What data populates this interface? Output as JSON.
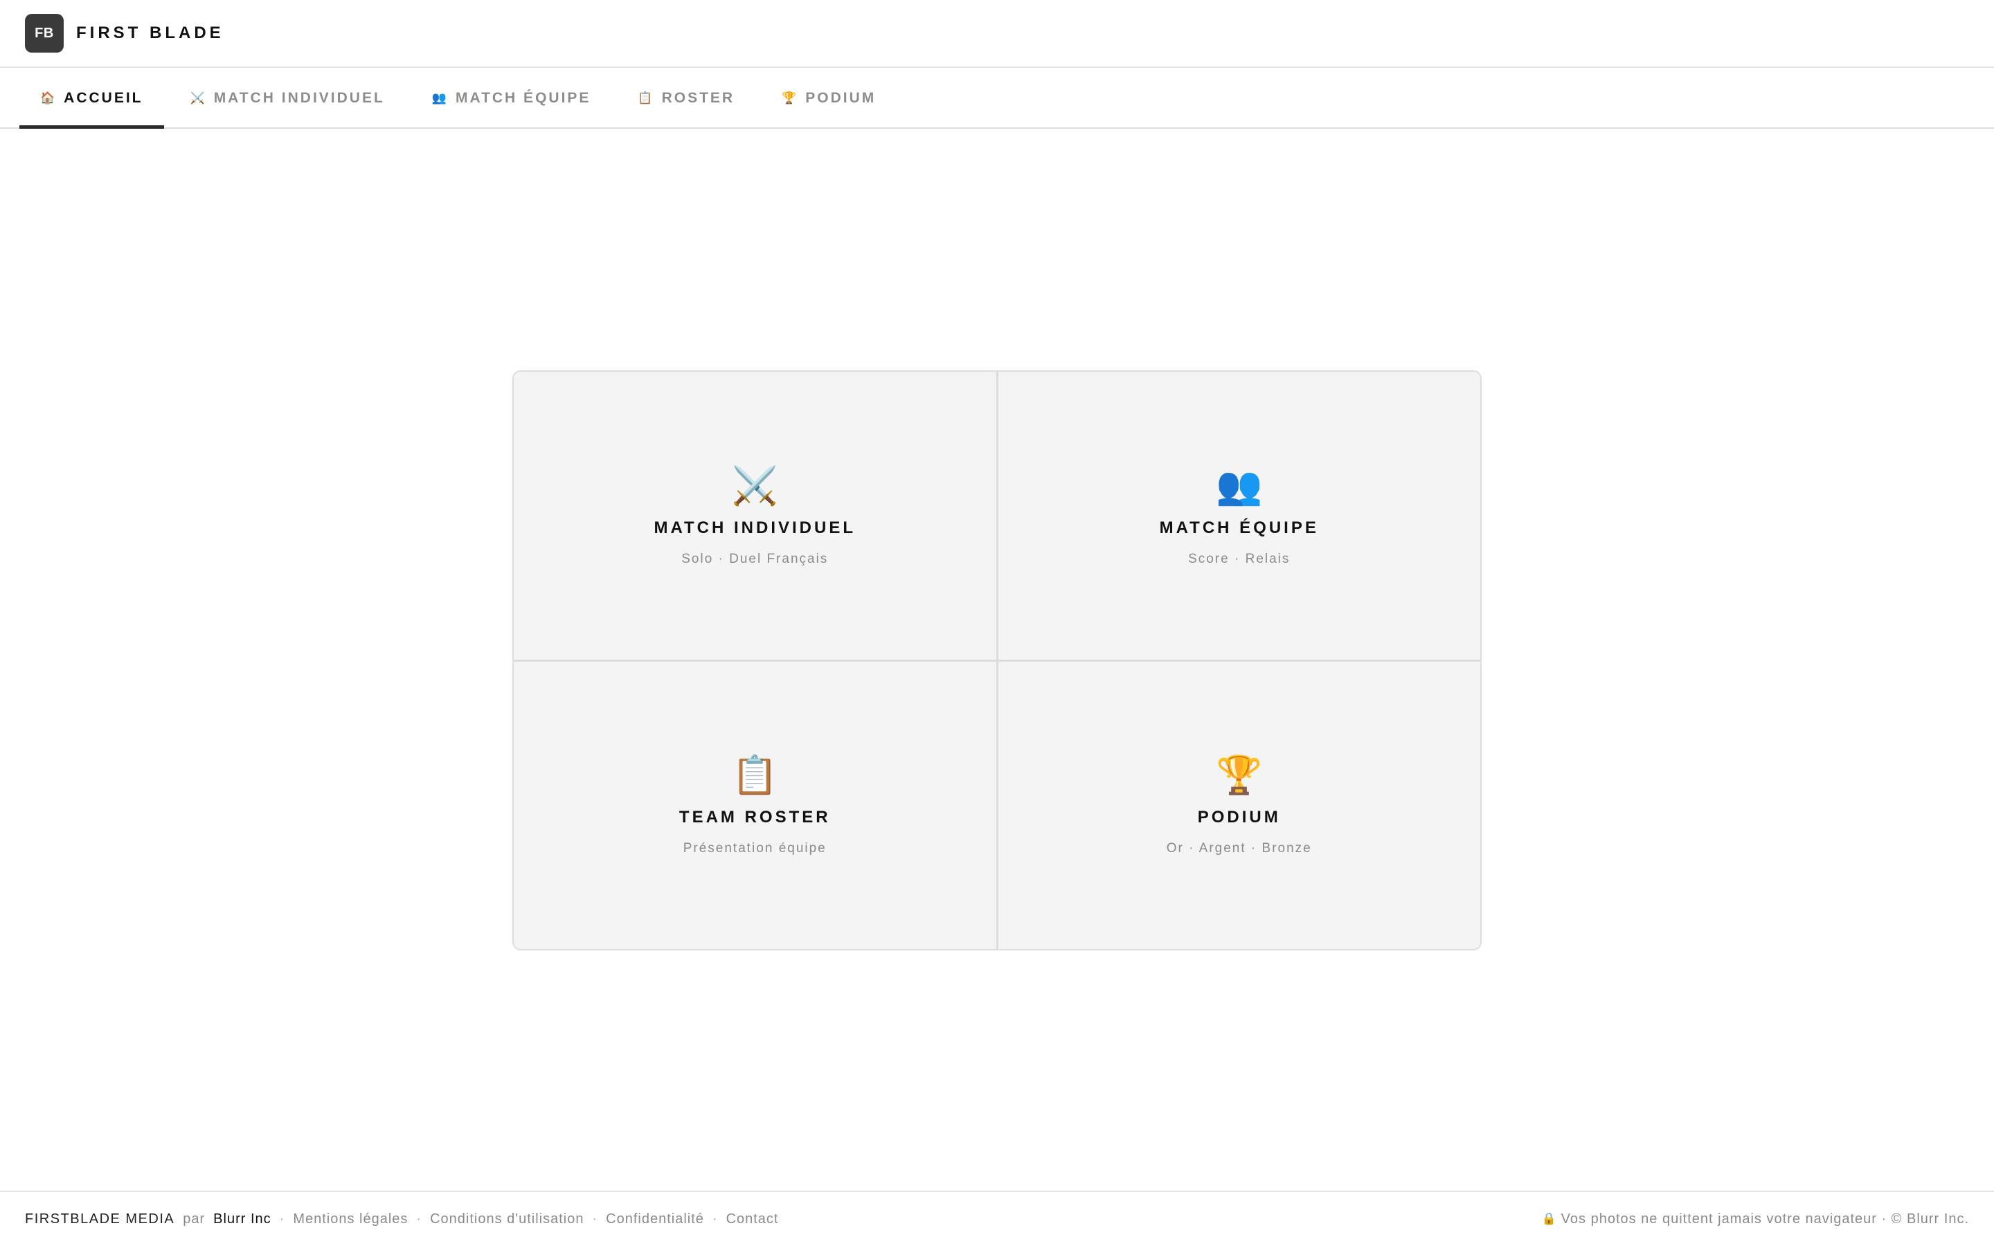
{
  "header": {
    "logo_text": "FB",
    "brand": "FIRST BLADE"
  },
  "nav": {
    "tabs": [
      {
        "label": "ACCUEIL",
        "icon": "🏠",
        "icon_name": "home-icon",
        "active": true
      },
      {
        "label": "MATCH INDIVIDUEL",
        "icon": "⚔️",
        "icon_name": "crossed-swords-icon",
        "active": false
      },
      {
        "label": "MATCH ÉQUIPE",
        "icon": "👥",
        "icon_name": "people-icon",
        "active": false
      },
      {
        "label": "ROSTER",
        "icon": "📋",
        "icon_name": "clipboard-icon",
        "active": false
      },
      {
        "label": "PODIUM",
        "icon": "🏆",
        "icon_name": "trophy-icon",
        "active": false
      }
    ]
  },
  "cards": [
    {
      "icon": "⚔️",
      "icon_name": "crossed-swords-icon",
      "title": "MATCH INDIVIDUEL",
      "subtitle": "Solo · Duel Français"
    },
    {
      "icon": "👥",
      "icon_name": "people-icon",
      "title": "MATCH ÉQUIPE",
      "subtitle": "Score · Relais"
    },
    {
      "icon": "📋",
      "icon_name": "clipboard-icon",
      "title": "TEAM ROSTER",
      "subtitle": "Présentation équipe"
    },
    {
      "icon": "🏆",
      "icon_name": "trophy-icon",
      "title": "PODIUM",
      "subtitle": "Or · Argent · Bronze"
    }
  ],
  "footer": {
    "brand": "FIRSTBLADE MEDIA",
    "par": "par",
    "owner": "Blurr Inc",
    "separator": "·",
    "links": [
      "Mentions légales",
      "Conditions d'utilisation",
      "Confidentialité",
      "Contact"
    ],
    "lock_icon": "🔒",
    "notice": "Vos photos ne quittent jamais votre navigateur · © Blurr Inc."
  },
  "colors": {
    "logo_bg": "#3a3a3a",
    "active_tab_underline": "#2b2b2b",
    "card_bg": "#f4f4f4",
    "muted_text": "#8a8a8a"
  }
}
